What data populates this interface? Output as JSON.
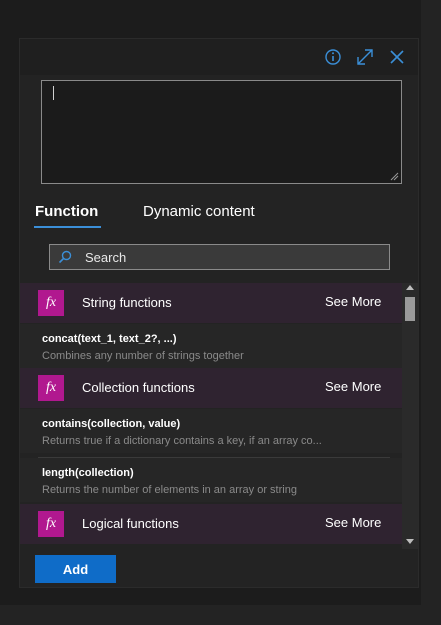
{
  "colors": {
    "accent": "#3b8fd8",
    "primary_button": "#0f6cc8",
    "fx_badge": "#b1188f",
    "category_header_bg": "#2f2330"
  },
  "header": {
    "icons": [
      "info-icon",
      "expand-icon",
      "close-icon"
    ]
  },
  "expression_editor": {
    "value": ""
  },
  "tabs": [
    {
      "label": "Function",
      "active": true
    },
    {
      "label": "Dynamic content",
      "active": false
    }
  ],
  "search": {
    "placeholder": "Search",
    "value": ""
  },
  "categories": [
    {
      "icon_text": "fx",
      "name": "String functions",
      "see_more": "See More",
      "functions": [
        {
          "name": "concat(text_1, text_2?, ...)",
          "description": "Combines any number of strings together"
        }
      ]
    },
    {
      "icon_text": "fx",
      "name": "Collection functions",
      "see_more": "See More",
      "functions": [
        {
          "name": "contains(collection, value)",
          "description": "Returns true if a dictionary contains a key, if an array co..."
        },
        {
          "name": "length(collection)",
          "description": "Returns the number of elements in an array or string"
        }
      ]
    },
    {
      "icon_text": "fx",
      "name": "Logical functions",
      "see_more": "See More",
      "functions": []
    }
  ],
  "footer": {
    "add_label": "Add"
  }
}
